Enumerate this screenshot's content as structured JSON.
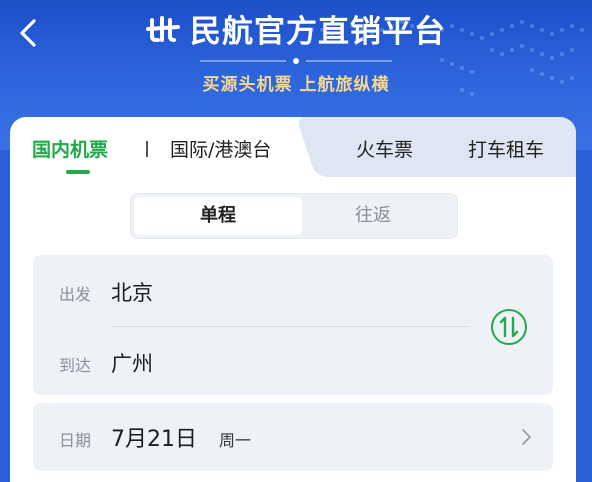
{
  "header": {
    "title": "民航官方直销平台",
    "slogan": "买源头机票 上航旅纵横"
  },
  "tabs": [
    {
      "label": "国内机票",
      "active": true
    },
    {
      "label": "国际/港澳台",
      "active": false
    },
    {
      "label": "火车票",
      "active": false
    },
    {
      "label": "打车租车",
      "active": false
    }
  ],
  "trip_type": {
    "options": [
      "单程",
      "往返"
    ],
    "selected": "单程"
  },
  "route": {
    "from_label": "出发",
    "from_city": "北京",
    "to_label": "到达",
    "to_city": "广州"
  },
  "date": {
    "label": "日期",
    "value": "7月21日",
    "weekday": "周一"
  },
  "colors": {
    "accent_green": "#23a84a",
    "header_blue": "#2e66de",
    "slogan_gold": "#f6d58f"
  },
  "icons": [
    "back-arrow-icon",
    "airline-logo-icon",
    "swap-icon",
    "chevron-right-icon"
  ]
}
